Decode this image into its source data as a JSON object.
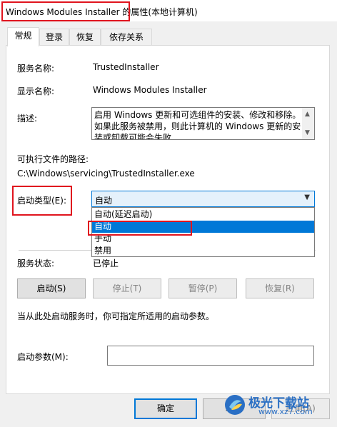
{
  "window": {
    "title_name": "Windows Modules Installer",
    "title_suffix": " 的属性(本地计算机)"
  },
  "tabs": [
    {
      "label": "常规"
    },
    {
      "label": "登录"
    },
    {
      "label": "恢复"
    },
    {
      "label": "依存关系"
    }
  ],
  "general": {
    "service_name_label": "服务名称:",
    "service_name_value": "TrustedInstaller",
    "display_name_label": "显示名称:",
    "display_name_value": "Windows Modules Installer",
    "description_label": "描述:",
    "description_value": "启用 Windows 更新和可选组件的安装、修改和移除。如果此服务被禁用，则此计算机的 Windows 更新的安装或卸载可能会失败",
    "exe_path_label": "可执行文件的路径:",
    "exe_path_value": "C:\\Windows\\servicing\\TrustedInstaller.exe",
    "startup_type_label": "启动类型(E):",
    "startup_type_value": "自动",
    "startup_options": [
      "自动(延迟启动)",
      "自动",
      "手动",
      "禁用"
    ],
    "service_status_label": "服务状态:",
    "service_status_value": "已停止",
    "start_button": "启动(S)",
    "stop_button": "停止(T)",
    "pause_button": "暂停(P)",
    "resume_button": "恢复(R)",
    "hint_text": "当从此处启动服务时，你可指定所适用的启动参数。",
    "start_params_label": "启动参数(M):",
    "start_params_value": ""
  },
  "footer": {
    "ok_button": "确定",
    "cancel_button": "取消",
    "apply_button": "应用(A)"
  },
  "watermark": {
    "brand": "极光下载站",
    "url": "www.xz7.com"
  },
  "colors": {
    "highlight_border": "#e0141e",
    "selection": "#0078d7"
  }
}
